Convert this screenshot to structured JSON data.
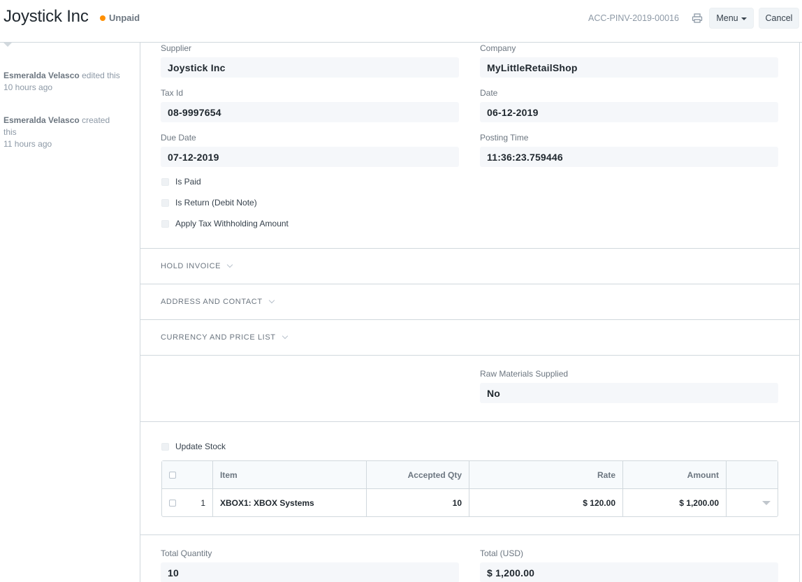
{
  "header": {
    "title": "Joystick Inc",
    "status": "Unpaid",
    "status_color": "#ff8f00",
    "doc_name": "ACC-PINV-2019-00016",
    "print_icon": "printer-icon",
    "menu_label": "Menu",
    "cancel_label": "Cancel"
  },
  "timeline": {
    "items": [
      {
        "user": "Esmeralda Velasco",
        "action": "edited this",
        "time": "10 hours ago"
      },
      {
        "user": "Esmeralda Velasco",
        "action": "created this",
        "time": "11 hours ago"
      }
    ]
  },
  "form": {
    "supplier": {
      "label": "Supplier",
      "value": "Joystick Inc"
    },
    "company": {
      "label": "Company",
      "value": "MyLittleRetailShop"
    },
    "tax_id": {
      "label": "Tax Id",
      "value": "08-9997654"
    },
    "date": {
      "label": "Date",
      "value": "06-12-2019"
    },
    "due_date": {
      "label": "Due Date",
      "value": "07-12-2019"
    },
    "posting_time": {
      "label": "Posting Time",
      "value": "11:36:23.759446"
    },
    "is_paid": {
      "label": "Is Paid",
      "checked": false
    },
    "is_return": {
      "label": "Is Return (Debit Note)",
      "checked": false
    },
    "apply_tds": {
      "label": "Apply Tax Withholding Amount",
      "checked": false
    },
    "raw_materials": {
      "label": "Raw Materials Supplied",
      "value": "No"
    },
    "update_stock": {
      "label": "Update Stock",
      "checked": false
    },
    "total_qty": {
      "label": "Total Quantity",
      "value": "10"
    },
    "total": {
      "label": "Total (USD)",
      "value": "$ 1,200.00"
    }
  },
  "sections": {
    "hold_invoice": "HOLD INVOICE",
    "address_contact": "ADDRESS AND CONTACT",
    "currency_price_list": "CURRENCY AND PRICE LIST"
  },
  "items_table": {
    "columns": {
      "item": "Item",
      "accepted_qty": "Accepted Qty",
      "rate": "Rate",
      "amount": "Amount"
    },
    "rows": [
      {
        "idx": "1",
        "item": "XBOX1: XBOX Systems",
        "accepted_qty": "10",
        "rate": "$ 120.00",
        "amount": "$ 1,200.00"
      }
    ]
  }
}
